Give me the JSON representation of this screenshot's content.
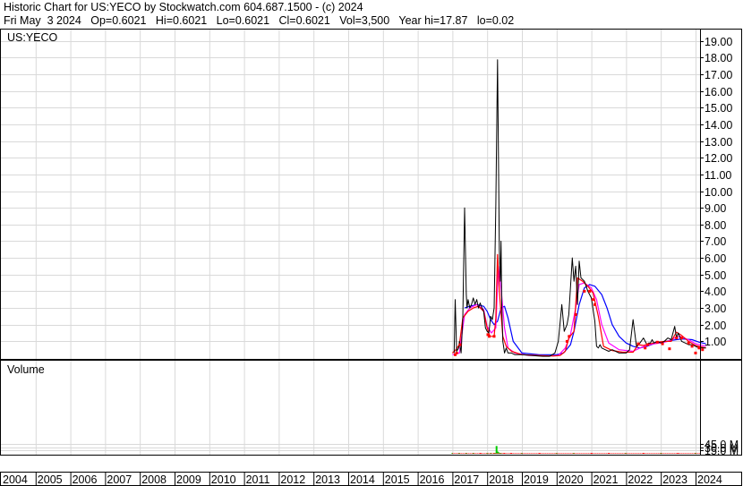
{
  "header": {
    "line1": "Historic Chart for US:YECO by Stockwatch.com 604.687.1500 - (c) 2024",
    "line2": "Fri May  3 2024   Op=0.6021   Hi=0.6021   Lo=0.6021   Cl=0.6021   Vol=3,500   Year hi=17.87   lo=0.02"
  },
  "chart_data": [
    {
      "type": "line",
      "title": "US:YECO",
      "y_ticks": [
        "19.00",
        "18.00",
        "17.00",
        "16.00",
        "15.00",
        "14.00",
        "13.00",
        "12.00",
        "11.00",
        "10.00",
        "9.00",
        "8.00",
        "7.00",
        "6.00",
        "5.00",
        "4.00",
        "3.00",
        "2.00",
        "1.00"
      ],
      "y_axis_side": "right",
      "x_ticks": [
        "2004",
        "2005",
        "2006",
        "2007",
        "2008",
        "2009",
        "2010",
        "2011",
        "2012",
        "2013",
        "2014",
        "2015",
        "2016",
        "2017",
        "2018",
        "2019",
        "2020",
        "2021",
        "2022",
        "2023",
        "2024"
      ],
      "grid": true,
      "colors": {
        "price": "#000000",
        "ma_short": "#ff0000",
        "ma_mid": "#ff00ff",
        "ma_long": "#0000ff",
        "grid": "#d9d9d9"
      },
      "series": [
        {
          "key": "price",
          "x": [
            2017.05,
            2017.08,
            2017.12,
            2017.18,
            2017.2,
            2017.25,
            2017.3,
            2017.35,
            2017.4,
            2017.42,
            2017.45,
            2017.5,
            2017.55,
            2017.6,
            2017.65,
            2017.7,
            2017.75,
            2017.8,
            2017.85,
            2017.9,
            2017.95,
            2018.0,
            2018.05,
            2018.1,
            2018.15,
            2018.2,
            2018.25,
            2018.3,
            2018.35,
            2018.38,
            2018.4,
            2018.42,
            2018.45,
            2018.48,
            2018.5,
            2018.55,
            2018.6,
            2018.7,
            2018.8,
            2019.0,
            2019.3,
            2019.6,
            2019.8,
            2019.95,
            2020.05,
            2020.15,
            2020.22,
            2020.3,
            2020.35,
            2020.45,
            2020.5,
            2020.55,
            2020.6,
            2020.65,
            2020.7,
            2020.8,
            2020.9,
            2021.0,
            2021.1,
            2021.15,
            2021.2,
            2021.25,
            2021.3,
            2021.4,
            2021.5,
            2021.6,
            2021.7,
            2021.8,
            2022.0,
            2022.1,
            2022.2,
            2022.3,
            2022.4,
            2022.5,
            2022.6,
            2022.65,
            2022.7,
            2022.75,
            2022.8,
            2022.9,
            2023.0,
            2023.1,
            2023.2,
            2023.3,
            2023.4,
            2023.45,
            2023.5,
            2023.6,
            2023.7,
            2023.8,
            2023.9,
            2024.0,
            2024.1,
            2024.2,
            2024.3
          ],
          "y": [
            0.3,
            3.5,
            0.4,
            0.6,
            1.0,
            0.3,
            2.4,
            9.0,
            3.8,
            3.0,
            3.5,
            3.0,
            3.2,
            3.6,
            3.2,
            3.5,
            3.0,
            3.3,
            3.0,
            2.8,
            1.8,
            1.6,
            1.5,
            2.5,
            2.3,
            3.0,
            9.2,
            17.87,
            6.5,
            4.6,
            7.0,
            3.2,
            1.0,
            0.6,
            0.3,
            0.6,
            0.3,
            0.3,
            0.2,
            0.2,
            0.15,
            0.1,
            0.1,
            0.3,
            1.0,
            3.2,
            1.6,
            2.0,
            2.6,
            6.0,
            4.6,
            5.5,
            3.2,
            5.8,
            4.8,
            4.6,
            4.0,
            3.6,
            2.2,
            0.7,
            0.6,
            0.8,
            0.6,
            0.5,
            0.4,
            0.5,
            0.4,
            0.3,
            0.3,
            0.5,
            2.3,
            0.7,
            0.9,
            1.2,
            0.8,
            0.9,
            0.9,
            1.1,
            0.9,
            1.0,
            0.9,
            1.0,
            1.2,
            1.1,
            1.9,
            1.2,
            1.5,
            1.0,
            0.9,
            0.8,
            0.8,
            0.7,
            0.6,
            0.6,
            0.6
          ]
        },
        {
          "key": "ma_short",
          "x": [
            2017.0,
            2017.1,
            2017.2,
            2017.3,
            2017.45,
            2017.6,
            2017.75,
            2017.9,
            2018.0,
            2018.08,
            2018.2,
            2018.25,
            2018.3,
            2018.35,
            2018.45,
            2018.55,
            2018.7,
            2019.0,
            2019.5,
            2019.9,
            2020.1,
            2020.25,
            2020.35,
            2020.5,
            2020.6,
            2020.75,
            2020.9,
            2021.05,
            2021.2,
            2021.35,
            2021.6,
            2021.9,
            2022.2,
            2022.35,
            2022.5,
            2022.7,
            2022.9,
            2023.1,
            2023.3,
            2023.45,
            2023.6,
            2023.8,
            2024.0,
            2024.3
          ],
          "y": [
            0.3,
            0.5,
            0.8,
            2.4,
            2.8,
            3.0,
            3.1,
            2.8,
            1.8,
            1.3,
            1.3,
            2.4,
            6.2,
            4.0,
            1.3,
            0.7,
            0.4,
            0.2,
            0.15,
            0.12,
            0.15,
            0.4,
            1.2,
            1.6,
            4.8,
            4.6,
            4.3,
            3.9,
            2.5,
            0.7,
            0.45,
            0.35,
            0.35,
            0.8,
            0.75,
            0.85,
            0.95,
            1.0,
            1.0,
            1.55,
            1.35,
            1.0,
            0.75,
            0.6
          ]
        },
        {
          "key": "ma_mid",
          "x": [
            2017.0,
            2017.2,
            2017.35,
            2017.5,
            2017.7,
            2017.9,
            2018.0,
            2018.12,
            2018.25,
            2018.32,
            2018.4,
            2018.5,
            2018.6,
            2018.8,
            2019.2,
            2019.7,
            2020.05,
            2020.25,
            2020.4,
            2020.55,
            2020.65,
            2020.8,
            2021.0,
            2021.15,
            2021.3,
            2021.5,
            2021.8,
            2022.2,
            2022.4,
            2022.6,
            2022.8,
            2023.0,
            2023.2,
            2023.4,
            2023.55,
            2023.8,
            2024.0,
            2024.3
          ],
          "y": [
            0.2,
            0.3,
            2.6,
            3.0,
            3.2,
            2.9,
            1.9,
            1.5,
            1.8,
            5.5,
            4.2,
            1.8,
            0.6,
            0.3,
            0.15,
            0.12,
            0.15,
            0.6,
            1.4,
            3.0,
            4.4,
            4.5,
            4.2,
            3.5,
            2.0,
            0.9,
            0.5,
            0.4,
            0.6,
            0.75,
            0.85,
            0.9,
            1.0,
            1.2,
            1.3,
            1.1,
            0.85,
            0.7
          ]
        },
        {
          "key": "ma_long",
          "x": [
            2017.35,
            2017.5,
            2017.7,
            2017.9,
            2018.0,
            2018.1,
            2018.2,
            2018.3,
            2018.4,
            2018.5,
            2018.6,
            2018.75,
            2019.0,
            2019.5,
            2020.0,
            2020.2,
            2020.4,
            2020.5,
            2020.65,
            2020.8,
            2020.95,
            2021.1,
            2021.3,
            2021.45,
            2021.6,
            2021.8,
            2022.0,
            2022.2,
            2022.4,
            2022.6,
            2022.8,
            2023.0,
            2023.3,
            2023.6,
            2023.9,
            2024.1,
            2024.3
          ],
          "y": [
            3.0,
            3.1,
            3.2,
            3.1,
            2.8,
            2.3,
            2.0,
            2.2,
            3.0,
            3.1,
            2.4,
            1.0,
            0.3,
            0.2,
            0.2,
            0.3,
            0.8,
            1.6,
            3.2,
            4.2,
            4.4,
            4.3,
            3.8,
            3.0,
            2.0,
            1.3,
            0.9,
            0.7,
            0.6,
            0.7,
            0.85,
            0.95,
            1.05,
            1.15,
            1.1,
            0.95,
            0.85
          ]
        }
      ],
      "markers": {
        "key": "ma_short",
        "x": [
          2017.08,
          2017.12,
          2017.22,
          2018.02,
          2018.06,
          2018.2,
          2020.3,
          2020.36,
          2020.55,
          2020.8,
          2020.95,
          2021.05,
          2021.1,
          2022.35,
          2022.55,
          2022.62,
          2022.9,
          2023.05,
          2023.25,
          2023.45,
          2023.6,
          2023.8,
          2023.9,
          2024.0,
          2024.1,
          2024.2
        ],
        "y": [
          0.2,
          0.3,
          0.8,
          1.4,
          1.3,
          1.3,
          1.0,
          1.3,
          2.6,
          4.0,
          4.0,
          3.5,
          3.2,
          0.85,
          0.6,
          0.8,
          0.95,
          0.85,
          0.55,
          1.2,
          1.2,
          0.9,
          0.7,
          0.3,
          0.6,
          0.5
        ]
      }
    },
    {
      "type": "bar",
      "title": "Volume",
      "y_ticks": [
        "45.0 M",
        "30.0 M",
        "15.0 M"
      ],
      "y_axis_side": "right",
      "grid": true,
      "colors": {
        "volume_up": "#00cc00",
        "volume_down": "#ff0000",
        "grid": "#d9d9d9"
      },
      "x": [
        2017.0,
        2017.2,
        2017.4,
        2017.6,
        2017.8,
        2018.0,
        2018.1,
        2018.2,
        2018.24,
        2018.27,
        2018.3,
        2018.33,
        2018.36,
        2018.4,
        2018.5,
        2018.7,
        2019.0,
        2019.5,
        2020.0,
        2020.5,
        2021.0,
        2021.5,
        2022.0,
        2022.5,
        2023.0,
        2023.5,
        2024.0
      ],
      "values": [
        0.6,
        0.8,
        1.0,
        0.8,
        0.7,
        1.5,
        4.0,
        3.0,
        1.5,
        35.0,
        10.0,
        6.0,
        3.0,
        2.0,
        1.2,
        0.8,
        0.6,
        0.4,
        0.5,
        0.7,
        0.6,
        0.5,
        0.4,
        0.4,
        0.3,
        0.3,
        0.3
      ],
      "up": [
        true,
        true,
        true,
        true,
        false,
        true,
        true,
        false,
        true,
        true,
        true,
        true,
        true,
        true,
        false,
        false,
        true,
        false,
        true,
        true,
        false,
        false,
        true,
        false,
        true,
        false,
        true
      ]
    }
  ]
}
